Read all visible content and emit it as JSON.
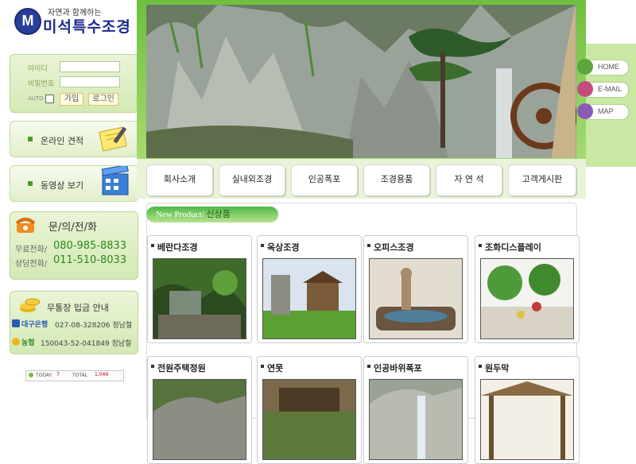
{
  "logo": {
    "tagline": "자연과 함께하는",
    "name": "미석특수조경",
    "mark": "M"
  },
  "login": {
    "id_label": "아이디",
    "pw_label": "비밀번호",
    "auto_label": "AUTO",
    "join_label": "가입",
    "login_label": "로그인"
  },
  "left_menu": [
    {
      "label": "온라인 견적"
    },
    {
      "label": "동영상 보기"
    }
  ],
  "contact": {
    "title": "문/의/전/화",
    "rows": [
      {
        "label": "무료전화/",
        "number": "080-985-8833"
      },
      {
        "label": "상담전화/",
        "number": "011-510-8033"
      }
    ]
  },
  "bank": {
    "title": "무통장 입금 안내",
    "rows": [
      {
        "bank": "대구은행",
        "account": "027-08-328206 정남철"
      },
      {
        "bank": "농협",
        "account": "150043-52-041849 정남철"
      }
    ]
  },
  "counter": {
    "today_label": "TODAY",
    "today": "7",
    "total_label": "TOTAL",
    "total": "1,049"
  },
  "side_buttons": [
    {
      "label": "HOME",
      "color": "#5aa63a"
    },
    {
      "label": "E-MAIL",
      "color": "#c24d7e"
    },
    {
      "label": "MAP",
      "color": "#8a5bb5"
    }
  ],
  "nav": [
    {
      "label": "회사소개"
    },
    {
      "label": "실내외조경"
    },
    {
      "label": "인공폭포"
    },
    {
      "label": "조경용품"
    },
    {
      "label": "자 연 석"
    },
    {
      "label": "고객게시판"
    }
  ],
  "new_product": {
    "en": "New Product/",
    "ko": "신상품"
  },
  "products": [
    {
      "title": "베란다조경"
    },
    {
      "title": "옥상조경"
    },
    {
      "title": "오피스조경"
    },
    {
      "title": "조화디스플레이"
    },
    {
      "title": "전원주택정원"
    },
    {
      "title": "연못"
    },
    {
      "title": "인공바위폭포"
    },
    {
      "title": "원두막"
    }
  ],
  "colors": {
    "accent_green": "#6fbf3f",
    "brand_blue": "#1d2a8c",
    "phone_green": "#2c8a1a"
  }
}
